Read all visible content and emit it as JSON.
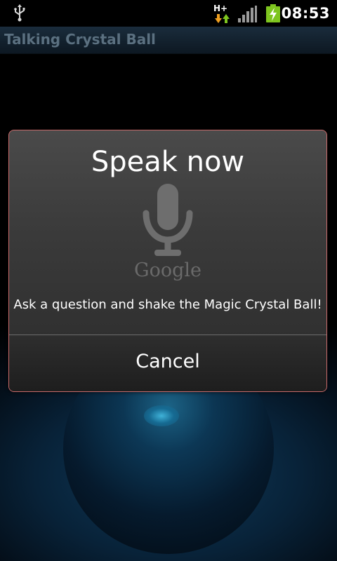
{
  "status_bar": {
    "usb_icon": "usb-icon",
    "network_label": "H+",
    "network_icon": "data-activity-icon",
    "signal_icon": "signal-strength-icon",
    "battery_icon": "battery-charging-icon",
    "clock": "08:53"
  },
  "app": {
    "title": "Talking Crystal Ball"
  },
  "dialog": {
    "title": "Speak now",
    "mic_icon": "microphone-icon",
    "brand": "Google",
    "prompt": "Ask a question and shake the Magic Crystal Ball!",
    "cancel_label": "Cancel",
    "border_color": "#c96b6b"
  },
  "colors": {
    "accent_green": "#7ec51f",
    "arrow_orange": "#f0a020",
    "arrow_green": "#7ec51f"
  }
}
